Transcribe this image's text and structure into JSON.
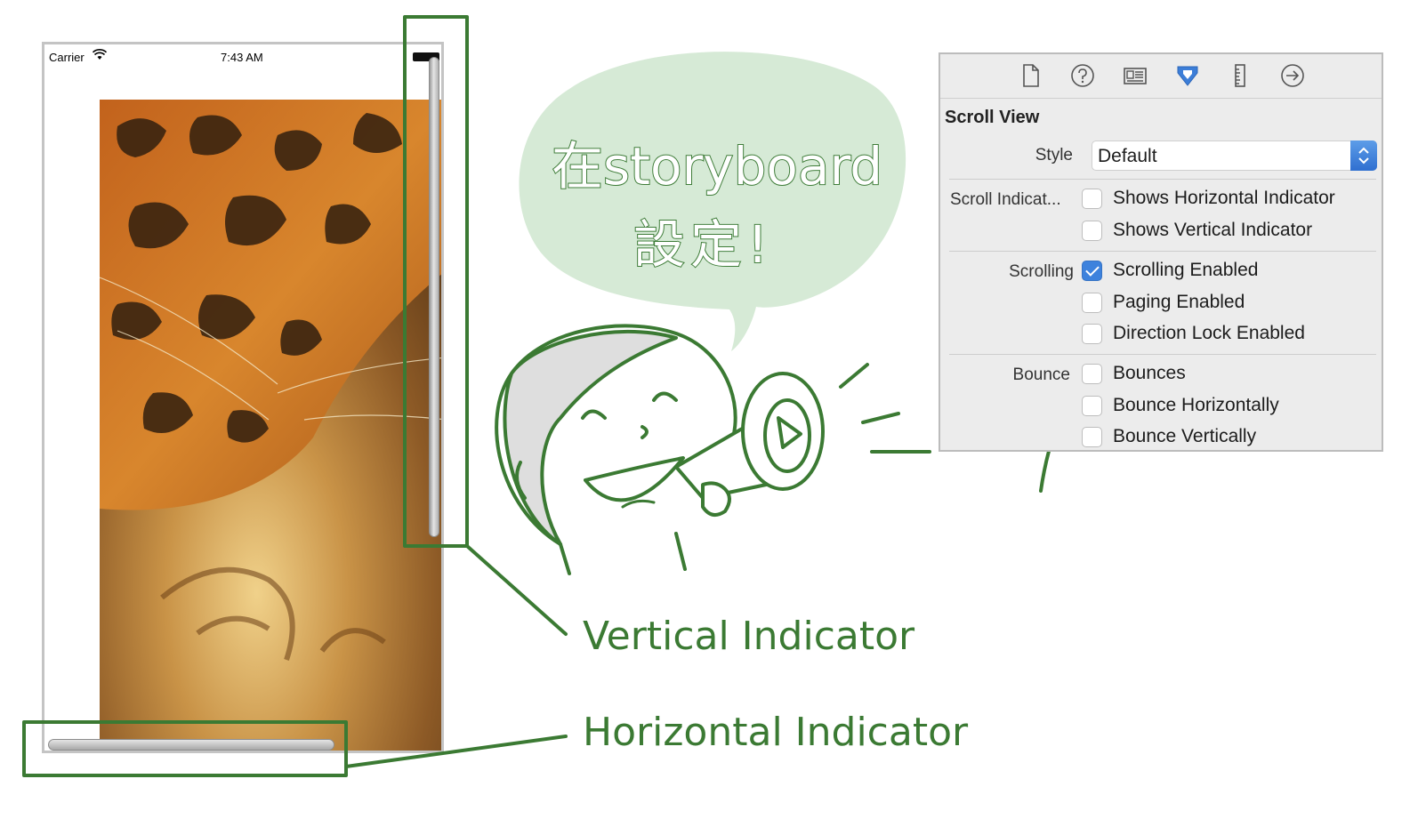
{
  "simulator": {
    "carrier": "Carrier",
    "time": "7:43 AM",
    "wifi_icon": "wifi-icon",
    "battery_icon": "battery-icon"
  },
  "annotations": {
    "vertical_label": "Vertical Indicator",
    "horizontal_label": "Horizontal Indicator",
    "bubble_line1": "在storyboard",
    "bubble_line2": "設定!",
    "accent_color": "#3b7a33",
    "bubble_color": "#d6ead6"
  },
  "inspector": {
    "toolbar_icons": [
      "file-icon",
      "help-icon",
      "identity-icon",
      "attributes-icon",
      "size-icon",
      "connections-icon"
    ],
    "active_tool": "attributes-icon",
    "section_title": "Scroll View",
    "style_label": "Style",
    "style_value": "Default",
    "indicators_label": "Scroll Indicat...",
    "shows_horizontal": {
      "label": "Shows Horizontal Indicator",
      "checked": false
    },
    "shows_vertical": {
      "label": "Shows Vertical Indicator",
      "checked": false
    },
    "scrolling_label": "Scrolling",
    "scrolling_enabled": {
      "label": "Scrolling Enabled",
      "checked": true
    },
    "paging_enabled": {
      "label": "Paging Enabled",
      "checked": false
    },
    "direction_lock": {
      "label": "Direction Lock Enabled",
      "checked": false
    },
    "bounce_label": "Bounce",
    "bounces": {
      "label": "Bounces",
      "checked": false
    },
    "bounce_horizontally": {
      "label": "Bounce Horizontally",
      "checked": false
    },
    "bounce_vertically": {
      "label": "Bounce Vertically",
      "checked": false
    }
  }
}
